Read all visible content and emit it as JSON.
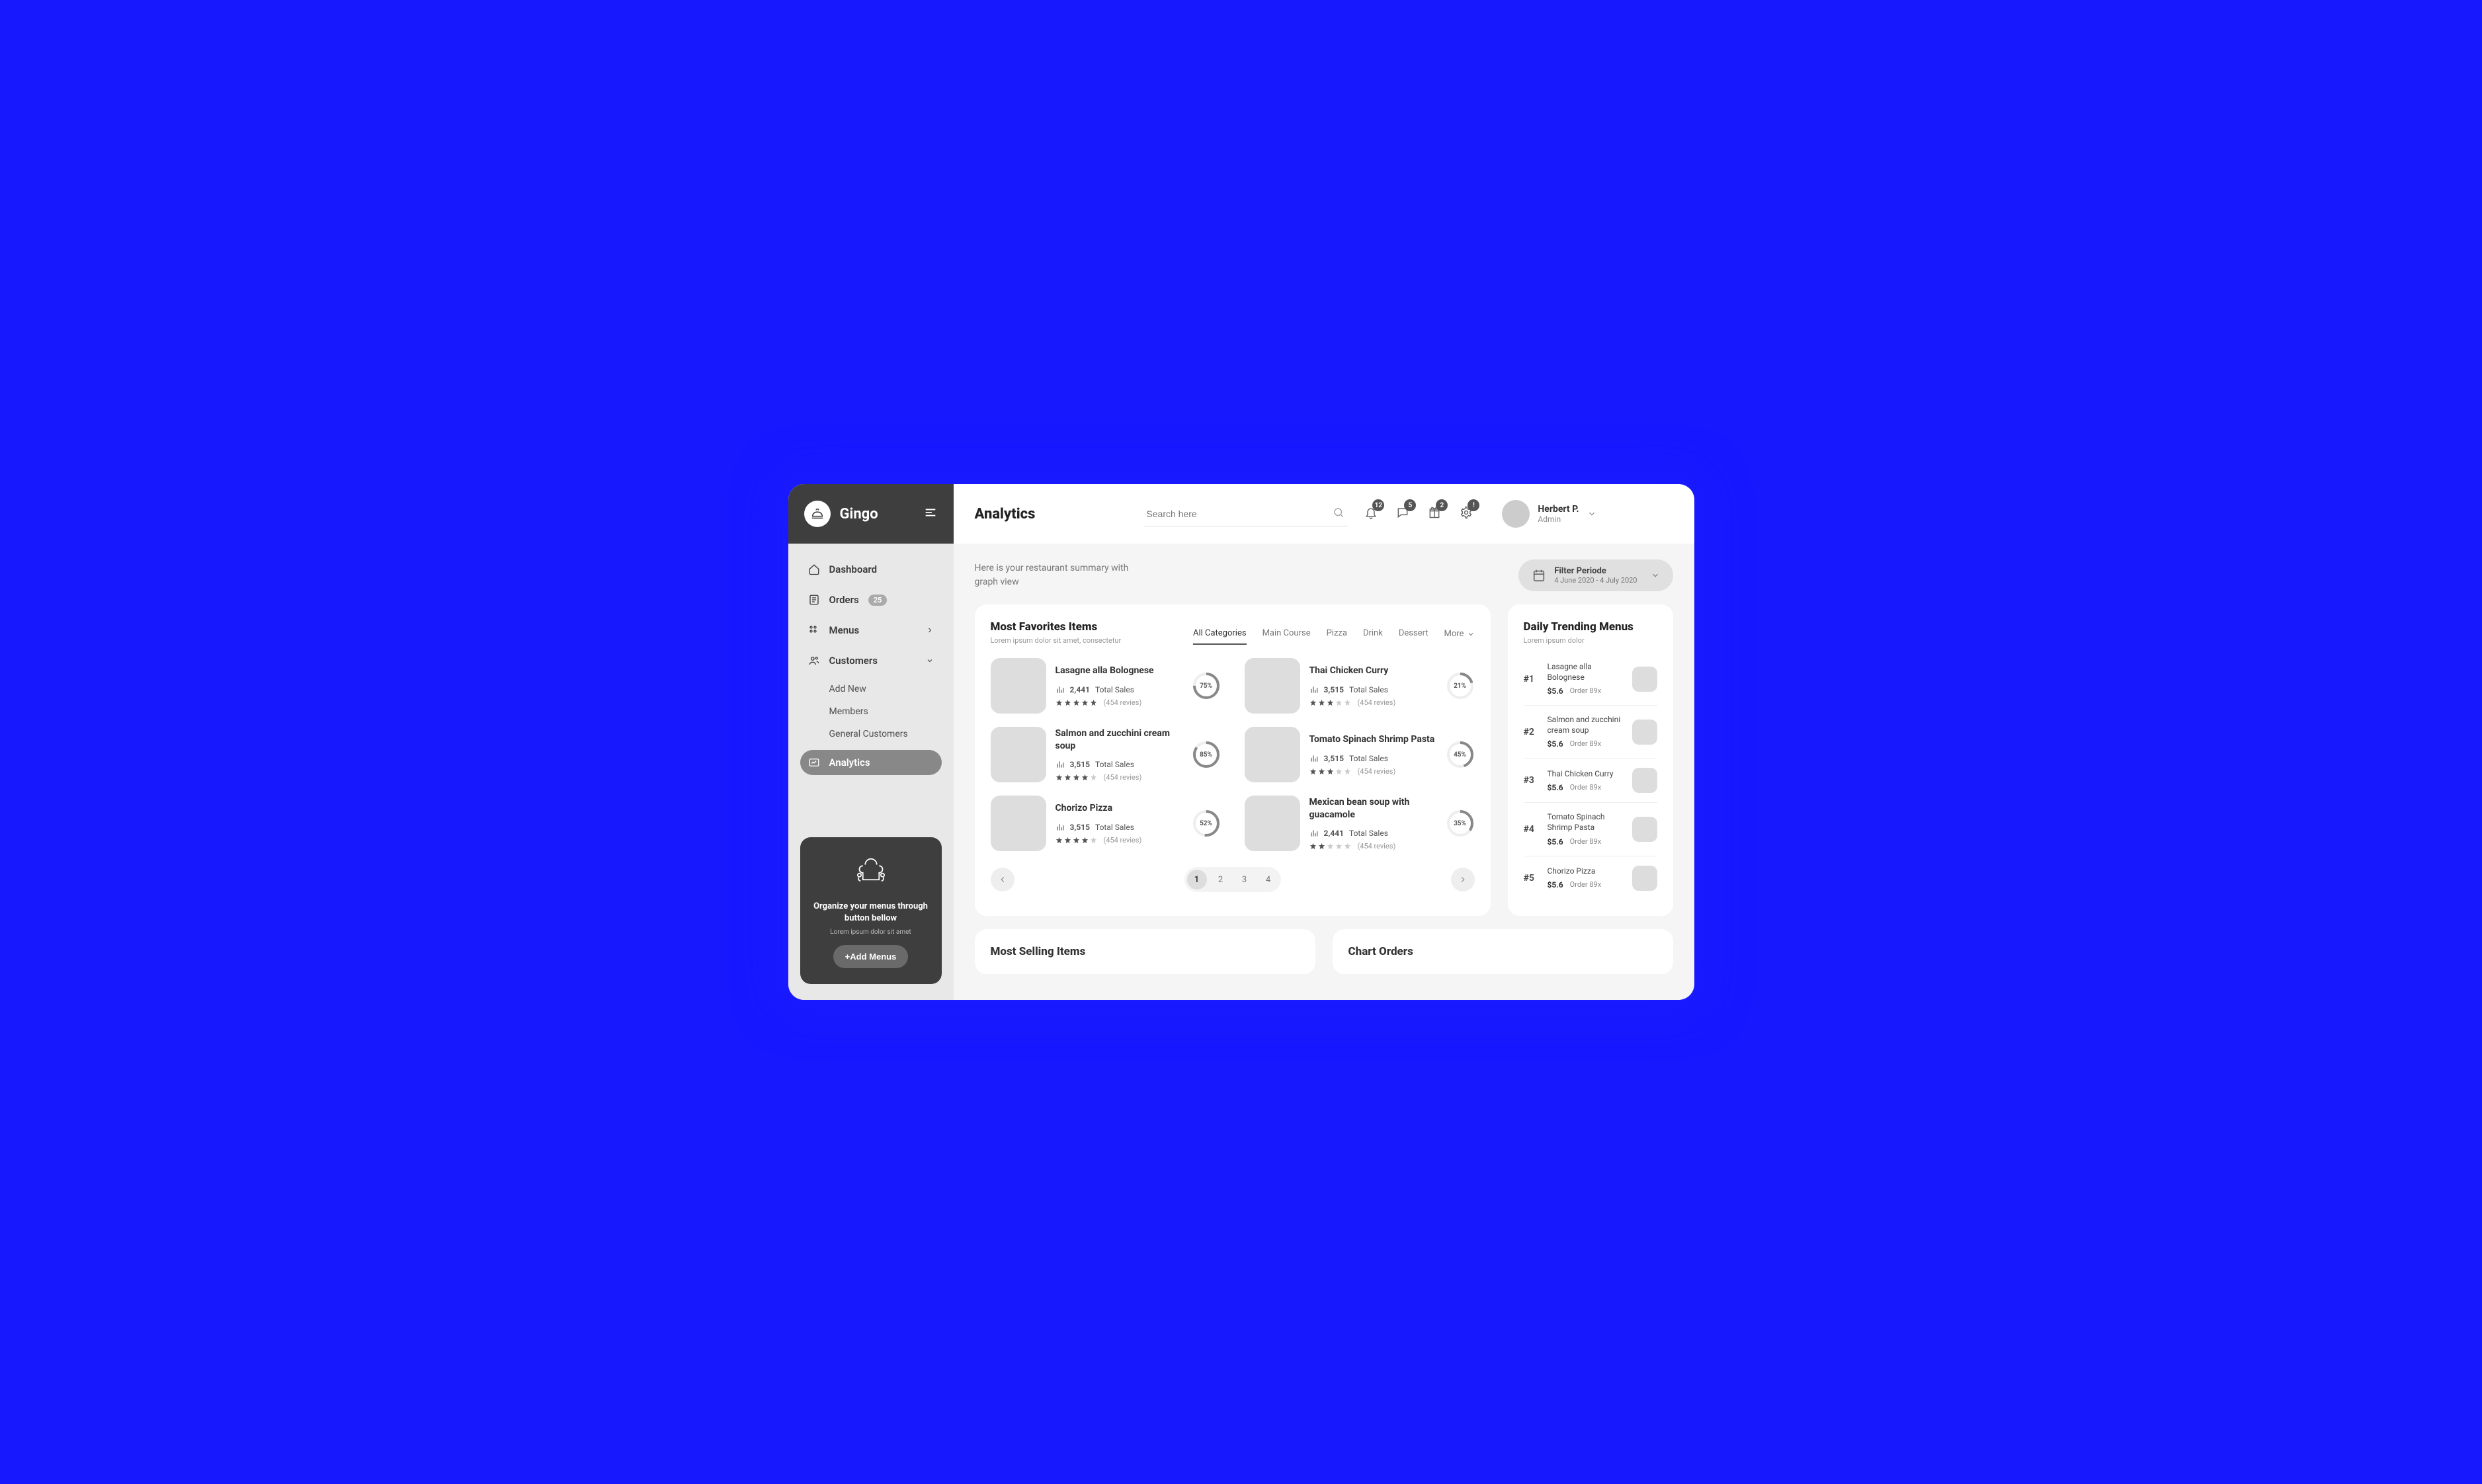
{
  "brand": "Gingo",
  "page_title": "Analytics",
  "search_placeholder": "Search here",
  "user": {
    "name": "Herbert P.",
    "role": "Admin"
  },
  "topbar_badges": {
    "bell": "12",
    "chat": "5",
    "gift": "2",
    "gear": "!"
  },
  "nav": {
    "dashboard": "Dashboard",
    "orders": "Orders",
    "orders_badge": "25",
    "menus": "Menus",
    "customers": "Customers",
    "customers_sub": {
      "add_new": "Add New",
      "members": "Members",
      "general": "General Customers"
    },
    "analytics": "Analytics"
  },
  "promo": {
    "title": "Organize your menus through button bellow",
    "sub": "Lorem ipsum dolor sit amet",
    "button": "+Add Menus"
  },
  "summary": "Here is your restaurant summary with graph view",
  "filter": {
    "label": "Filter Periode",
    "range": "4 June 2020 - 4 July 2020"
  },
  "favorites": {
    "title": "Most Favorites Items",
    "sub": "Lorem ipsum dolor sit amet, consectetur",
    "tabs": {
      "all": "All Categories",
      "main": "Main Course",
      "pizza": "Pizza",
      "drink": "Drink",
      "dessert": "Dessert",
      "more": "More"
    },
    "items": [
      {
        "name": "Lasagne alla Bolognese",
        "sales": "2,441",
        "sales_label": "Total Sales",
        "reviews": "(454 revies)",
        "pct": 75,
        "stars": 5
      },
      {
        "name": "Thai Chicken Curry",
        "sales": "3,515",
        "sales_label": "Total Sales",
        "reviews": "(454 revies)",
        "pct": 21,
        "stars": 3
      },
      {
        "name": "Salmon and zucchini cream soup",
        "sales": "3,515",
        "sales_label": "Total Sales",
        "reviews": "(454 revies)",
        "pct": 85,
        "stars": 4
      },
      {
        "name": "Tomato Spinach Shrimp Pasta",
        "sales": "3,515",
        "sales_label": "Total Sales",
        "reviews": "(454 revies)",
        "pct": 45,
        "stars": 3
      },
      {
        "name": "Chorizo Pizza",
        "sales": "3,515",
        "sales_label": "Total Sales",
        "reviews": "(454 revies)",
        "pct": 52,
        "stars": 4
      },
      {
        "name": "Mexican bean soup with guacamole",
        "sales": "2,441",
        "sales_label": "Total Sales",
        "reviews": "(454 revies)",
        "pct": 35,
        "stars": 2
      }
    ],
    "pages": [
      "1",
      "2",
      "3",
      "4"
    ]
  },
  "trending": {
    "title": "Daily Trending Menus",
    "sub": "Lorem ipsum dolor",
    "items": [
      {
        "rank": "#1",
        "name": "Lasagne alla Bolognese",
        "price": "$5.6",
        "order": "Order 89x"
      },
      {
        "rank": "#2",
        "name": "Salmon and zucchini cream soup",
        "price": "$5.6",
        "order": "Order 89x"
      },
      {
        "rank": "#3",
        "name": "Thai Chicken Curry",
        "price": "$5.6",
        "order": "Order 89x"
      },
      {
        "rank": "#4",
        "name": "Tomato Spinach Shrimp Pasta",
        "price": "$5.6",
        "order": "Order 89x"
      },
      {
        "rank": "#5",
        "name": "Chorizo Pizza",
        "price": "$5.6",
        "order": "Order 89x"
      }
    ]
  },
  "bottom": {
    "selling": "Most Selling Items",
    "chart": "Chart Orders"
  }
}
